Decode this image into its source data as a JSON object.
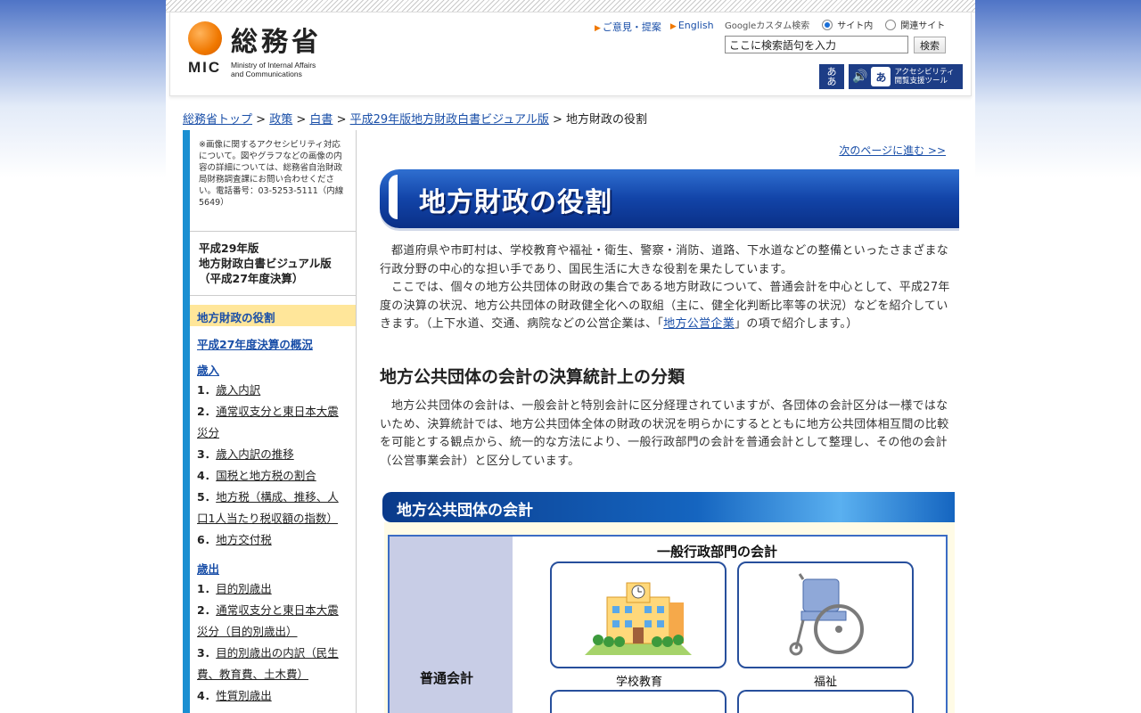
{
  "header": {
    "logo_kanji": "総務省",
    "logo_abbr": "MIC",
    "logo_en_line1": "Ministry of Internal Affairs",
    "logo_en_line2": "and Communications",
    "links": [
      {
        "label": "ご意見・提案"
      },
      {
        "label": "English"
      }
    ],
    "search": {
      "google_label": "Googleカスタム検索",
      "radio_site": "サイト内",
      "radio_related": "関連サイト",
      "placeholder": "ここに検索語句を入力",
      "button": "検索"
    },
    "accessibility": {
      "furigana_label": "あ\nあ",
      "tool_icon_text": "あ",
      "tool_line1": "アクセシビリティ",
      "tool_line2": "閲覧支援ツール"
    }
  },
  "breadcrumb": {
    "items": [
      "総務省トップ",
      "政策",
      "白書",
      "平成29年版地方財政白書ビジュアル版"
    ],
    "separator": ">",
    "current": "地方財政の役割"
  },
  "sidebar": {
    "note": "※画像に関するアクセシビリティ対応について。図やグラフなどの画像の内容の詳細については、総務省自治財政局財務調査課にお問い合わせください。電話番号：03-5253-5111（内線5649）",
    "title_line1": "平成29年版",
    "title_line2": "地方財政白書ビジュアル版",
    "title_line3": "（平成27年度決算）",
    "current": "地方財政の役割",
    "overview_link": "平成27年度決算の概況",
    "revenue": {
      "heading": "歳入",
      "items": [
        {
          "num": "1．",
          "label": "歳入内訳"
        },
        {
          "num": "2．",
          "label": "通常収支分と東日本大震災分"
        },
        {
          "num": "3．",
          "label": "歳入内訳の推移"
        },
        {
          "num": "4．",
          "label": "国税と地方税の割合"
        },
        {
          "num": "5．",
          "label": "地方税（構成、推移、人口1人当たり税収額の指数）"
        },
        {
          "num": "6．",
          "label": "地方交付税"
        }
      ]
    },
    "expenditure": {
      "heading": "歳出",
      "items": [
        {
          "num": "1．",
          "label": "目的別歳出"
        },
        {
          "num": "2．",
          "label": "通常収支分と東日本大震災分（目的別歳出）"
        },
        {
          "num": "3．",
          "label": "目的別歳出の内訳（民生費、教育費、土木費）"
        },
        {
          "num": "4．",
          "label": "性質別歳出"
        }
      ]
    }
  },
  "main": {
    "next_link": "次のページに進む >>",
    "title": "地方財政の役割",
    "para1": "都道府県や市町村は、学校教育や福祉・衛生、警察・消防、道路、下水道などの整備といったさまざまな行政分野の中心的な担い手であり、国民生活に大きな役割を果たしています。",
    "para2_a": "ここでは、個々の地方公共団体の財政の集合である地方財政について、普通会計を中心として、平成27年度の決算の状況、地方公共団体の財政健全化への取組（主に、健全化判断比率等の状況）などを紹介していきます。（上下水道、交通、病院などの公営企業は、「",
    "para2_link": "地方公営企業",
    "para2_b": "」の項で紹介します。）",
    "heading2": "地方公共団体の会計の決算統計上の分類",
    "para3": "地方公共団体の会計は、一般会計と特別会計に区分経理されていますが、各団体の会計区分は一様ではないため、決算統計では、地方公共団体全体の財政の状況を明らかにするとともに地方公共団体相互間の比較を可能とする観点から、統一的な方法により、一般行政部門の会計を普通会計として整理し、その他の会計（公営事業会計）と区分しています。",
    "figure": {
      "banner": "地方公共団体の会計",
      "row_label": "普通会計",
      "column_head": "一般行政部門の会計",
      "cards": [
        {
          "label": "学校教育",
          "icon": "school-icon"
        },
        {
          "label": "福祉",
          "icon": "wheelchair-icon"
        }
      ]
    }
  },
  "colors": {
    "accent": "#1a8fd2",
    "brand_orange": "#f07800",
    "banner_blue": "#1244a8",
    "highlight": "#ffe69a"
  }
}
